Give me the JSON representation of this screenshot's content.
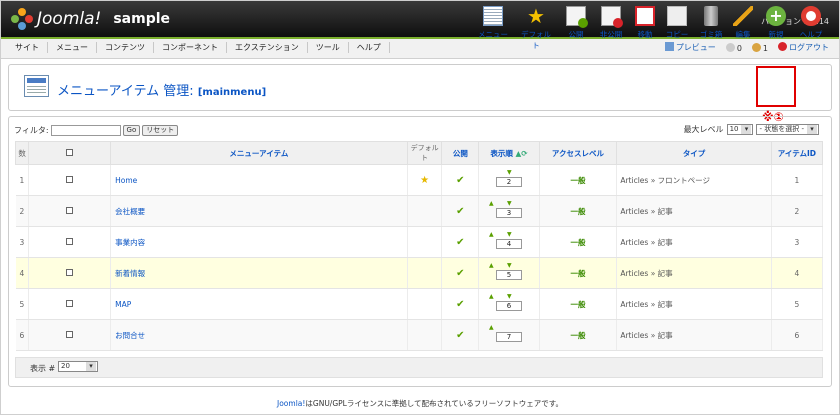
{
  "header": {
    "logo_text": "Joomla!",
    "site_name": "sample",
    "version": "バージョン 1.5.14"
  },
  "menu": [
    "サイト",
    "メニュー",
    "コンテンツ",
    "コンポーネント",
    "エクステンション",
    "ツール",
    "ヘルプ"
  ],
  "status": {
    "preview": "プレビュー",
    "messages": "0",
    "users": "1",
    "logout": "ログアウト"
  },
  "title": {
    "text": "メニューアイテム 管理:",
    "sub": "[mainmenu]"
  },
  "toolbar": [
    "メニュー",
    "デフォルト",
    "公開",
    "非公開",
    "移動",
    "コピー",
    "ゴミ箱",
    "編集",
    "新規",
    "ヘルプ"
  ],
  "note": "※①",
  "filter": {
    "label": "フィルタ:",
    "value": "",
    "go": "Go",
    "reset": "リセット"
  },
  "maxlevel": {
    "label": "最大レベル",
    "value": "10",
    "state": "- 状態を選択 -"
  },
  "columns": {
    "num": "数",
    "name": "メニューアイテム",
    "default": "デフォルト",
    "published": "公開",
    "order": "表示順",
    "access": "アクセスレベル",
    "type": "タイプ",
    "id": "アイテムID"
  },
  "rows": [
    {
      "n": "1",
      "name": "Home",
      "default": true,
      "order": "2",
      "access": "一般",
      "type": "Articles » フロントページ",
      "id": "1"
    },
    {
      "n": "2",
      "name": "会社概要",
      "default": false,
      "order": "3",
      "access": "一般",
      "type": "Articles » 記事",
      "id": "2"
    },
    {
      "n": "3",
      "name": "事業内容",
      "default": false,
      "order": "4",
      "access": "一般",
      "type": "Articles » 記事",
      "id": "3"
    },
    {
      "n": "4",
      "name": "新着情報",
      "default": false,
      "order": "5",
      "access": "一般",
      "type": "Articles » 記事",
      "id": "4"
    },
    {
      "n": "5",
      "name": "MAP",
      "default": false,
      "order": "6",
      "access": "一般",
      "type": "Articles » 記事",
      "id": "5"
    },
    {
      "n": "6",
      "name": "お問合せ",
      "default": false,
      "order": "7",
      "access": "一般",
      "type": "Articles » 記事",
      "id": "6"
    }
  ],
  "display": {
    "label": "表示 #",
    "value": "20"
  },
  "credit": {
    "link": "Joomla!",
    "text": "はGNU/GPLライセンスに準拠して配布されているフリーソフトウェアです。"
  }
}
